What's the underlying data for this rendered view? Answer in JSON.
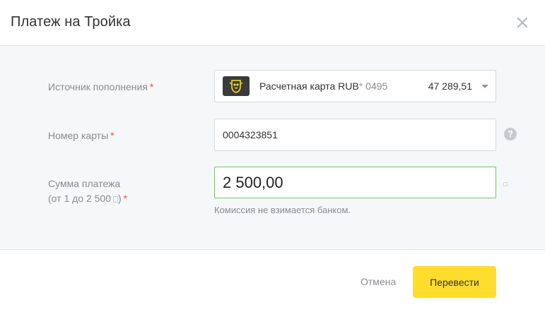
{
  "dialog": {
    "title": "Платеж на Тройка",
    "close_icon": "close-icon"
  },
  "form": {
    "source": {
      "label": "Источник пополнения",
      "required_mark": "*",
      "account_name": "Расчетная карта RUB",
      "account_star": "*",
      "account_number": "0495",
      "balance": "47 289,51",
      "logo_icon": "bank-coat-of-arms-icon",
      "dropdown_icon": "chevron-down-icon"
    },
    "card_number": {
      "label": "Номер карты",
      "required_mark": "*",
      "value": "0004323851",
      "help_icon": "question-mark-icon",
      "help_symbol": "?"
    },
    "amount": {
      "label_line1": "Сумма платежа",
      "label_line2_prefix": "(от 1 до 2 500",
      "label_line2_suffix": ")",
      "required_mark": "*",
      "value": "2 500,00",
      "hint": "Комиссия не взимается банком.",
      "currency_icon": "ruble-icon"
    }
  },
  "footer": {
    "cancel_label": "Отмена",
    "submit_label": "Перевести"
  },
  "colors": {
    "accent": "#ffdd2d",
    "active_border": "#73c16a",
    "required": "#e54f4f",
    "panel_background": "#f6f7f8"
  }
}
